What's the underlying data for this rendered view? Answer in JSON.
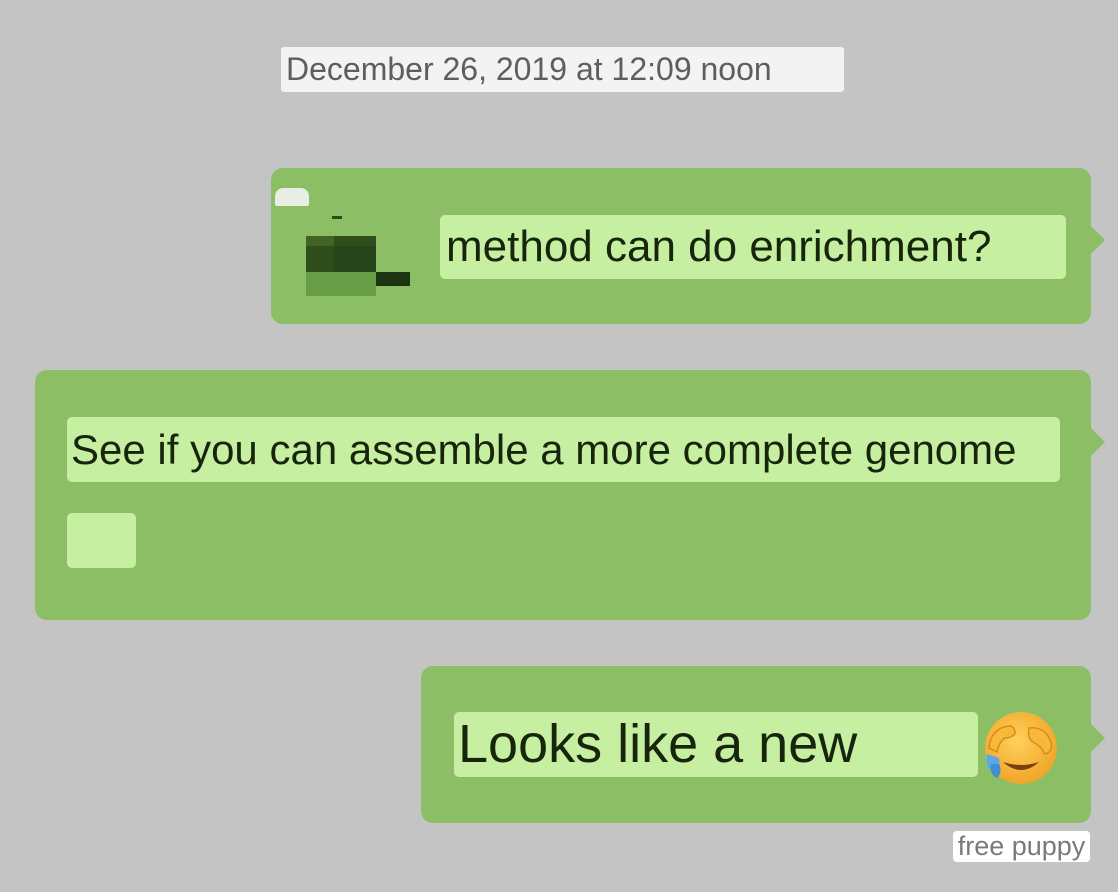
{
  "header": {
    "timestamp": "December 26, 2019 at 12:09 noon"
  },
  "messages": [
    {
      "text": "method can do enrichment?"
    },
    {
      "text": "See if you can assemble a more complete genome"
    },
    {
      "text": "Looks like a new",
      "trailing_icon": "face-covering-eyes-crying-emoji"
    }
  ],
  "watermark": {
    "text": "free puppy"
  },
  "colors": {
    "background": "#c4c4c4",
    "bubble": "#8cbe65",
    "highlight": "#c6efa1",
    "text": "#17250d",
    "timestamp_bg": "#f3f3f3",
    "timestamp_text": "#5e5e5e"
  }
}
